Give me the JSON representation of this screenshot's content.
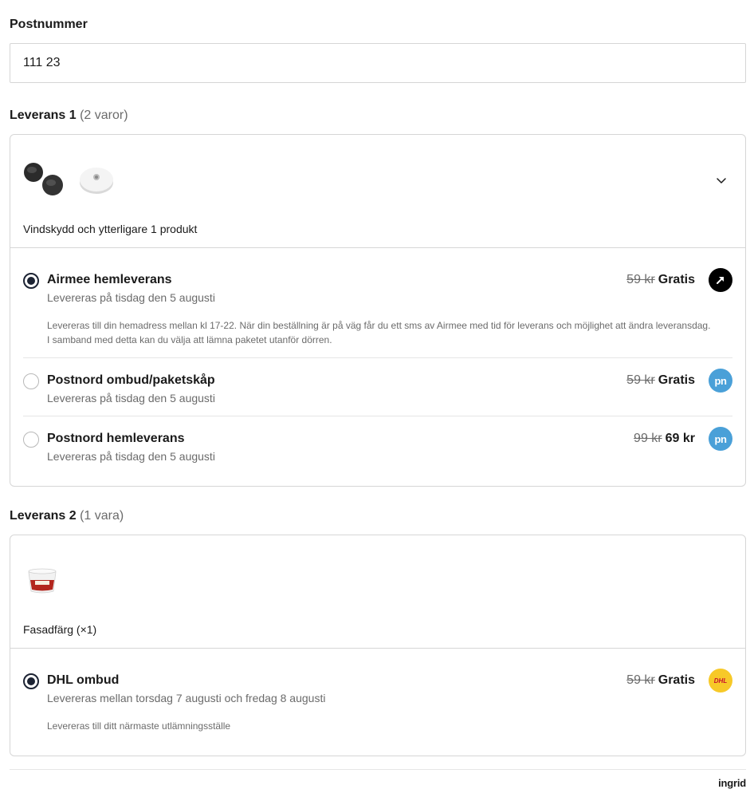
{
  "postal": {
    "label": "Postnummer",
    "value": "111 23"
  },
  "deliveries": [
    {
      "title": "Leverans 1",
      "count": "(2 varor)",
      "summary": "Vindskydd och ytterligare 1 produkt",
      "options": [
        {
          "name": "Airmee hemleverans",
          "date": "Levereras på tisdag den 5 augusti",
          "description": "Levereras till din hemadress mellan kl 17-22. När din beställning är på väg får du ett sms av Airmee med tid för leverans och möjlighet att ändra leveransdag. I samband med detta kan du välja att lämna paketet utanför dörren.",
          "old_price": "59 kr",
          "price": "Gratis",
          "selected": true,
          "carrier_icon": "airmee-logo"
        },
        {
          "name": "Postnord ombud/paketskåp",
          "date": "Levereras på tisdag den 5 augusti",
          "old_price": "59 kr",
          "price": "Gratis",
          "selected": false,
          "carrier_icon": "postnord-logo",
          "carrier_text": "pn"
        },
        {
          "name": "Postnord hemleverans",
          "date": "Levereras på tisdag den 5 augusti",
          "old_price": "99 kr",
          "price": "69 kr",
          "selected": false,
          "carrier_icon": "postnord-logo",
          "carrier_text": "pn"
        }
      ]
    },
    {
      "title": "Leverans 2",
      "count": "(1 vara)",
      "summary": "Fasadfärg (×1)",
      "options": [
        {
          "name": "DHL ombud",
          "date": "Levereras mellan torsdag 7 augusti och fredag 8 augusti",
          "description": "Levereras till ditt närmaste utlämningsställe",
          "old_price": "59 kr",
          "price": "Gratis",
          "selected": true,
          "carrier_icon": "dhl-logo",
          "carrier_text": "DHL"
        }
      ]
    }
  ],
  "footer": {
    "brand": "ingrid"
  },
  "colors": {
    "radio_selected": "#1c2333",
    "postnord": "#4aa0d8",
    "dhl": "#f7c928",
    "airmee": "#000000"
  }
}
